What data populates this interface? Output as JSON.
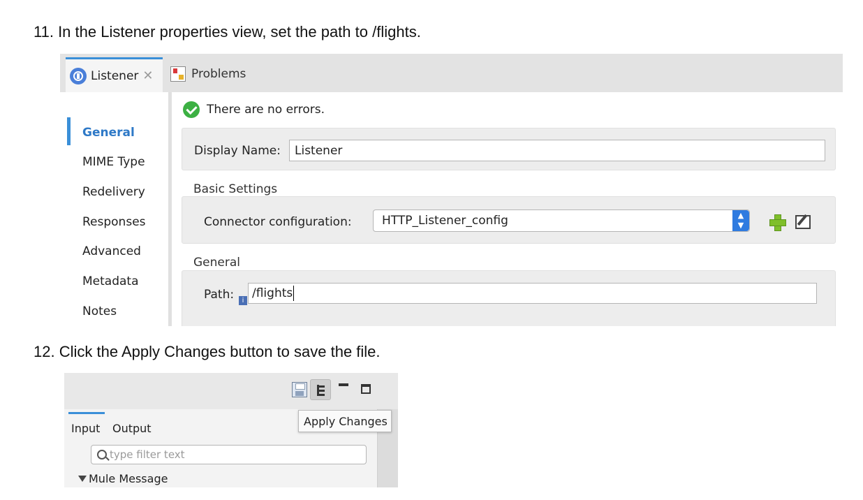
{
  "steps": {
    "step11": "11. In the Listener properties view, set the path to /flights.",
    "step12": "12. Click the Apply Changes button to save the file."
  },
  "properties": {
    "tabs": [
      {
        "label": "Listener",
        "icon": "listener-icon",
        "closable": true,
        "active": true
      },
      {
        "label": "Problems",
        "icon": "problems-icon",
        "active": false
      }
    ],
    "status": "There are no errors.",
    "sidebar": {
      "items": [
        "General",
        "MIME Type",
        "Redelivery",
        "Responses",
        "Advanced",
        "Metadata",
        "Notes"
      ],
      "active": "General"
    },
    "display_name_label": "Display Name:",
    "display_name_value": "Listener",
    "basic_settings_title": "Basic Settings",
    "connector_label": "Connector configuration:",
    "connector_value": "HTTP_Listener_config",
    "general_title": "General",
    "path_label": "Path:",
    "path_value": "/flights"
  },
  "editor": {
    "toolbar_icons": [
      "save-icon",
      "apply-changes-icon",
      "minimize-icon",
      "maximize-icon"
    ],
    "tooltip": "Apply Changes",
    "tabs": [
      "Input",
      "Output"
    ],
    "filter_placeholder": "type filter text",
    "tree_root": "Mule Message"
  },
  "colors": {
    "accent": "#3a8fd8",
    "active_sidebar": "#2e79c7",
    "success": "#3cb043"
  }
}
